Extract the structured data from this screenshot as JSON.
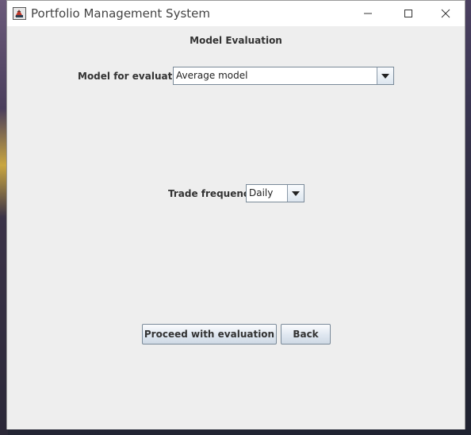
{
  "window": {
    "title": "Portfolio Management System"
  },
  "page": {
    "heading": "Model Evaluation"
  },
  "model_field": {
    "label": "Model for evaluation",
    "selected": "Average model"
  },
  "frequency_field": {
    "label": "Trade frequency",
    "selected": "Daily"
  },
  "buttons": {
    "proceed": "Proceed with evaluation",
    "back": "Back"
  },
  "icons": {
    "app": "java-app-icon",
    "minimize": "minimize-icon",
    "maximize": "maximize-icon",
    "close": "close-icon",
    "dropdown": "chevron-down-icon"
  }
}
